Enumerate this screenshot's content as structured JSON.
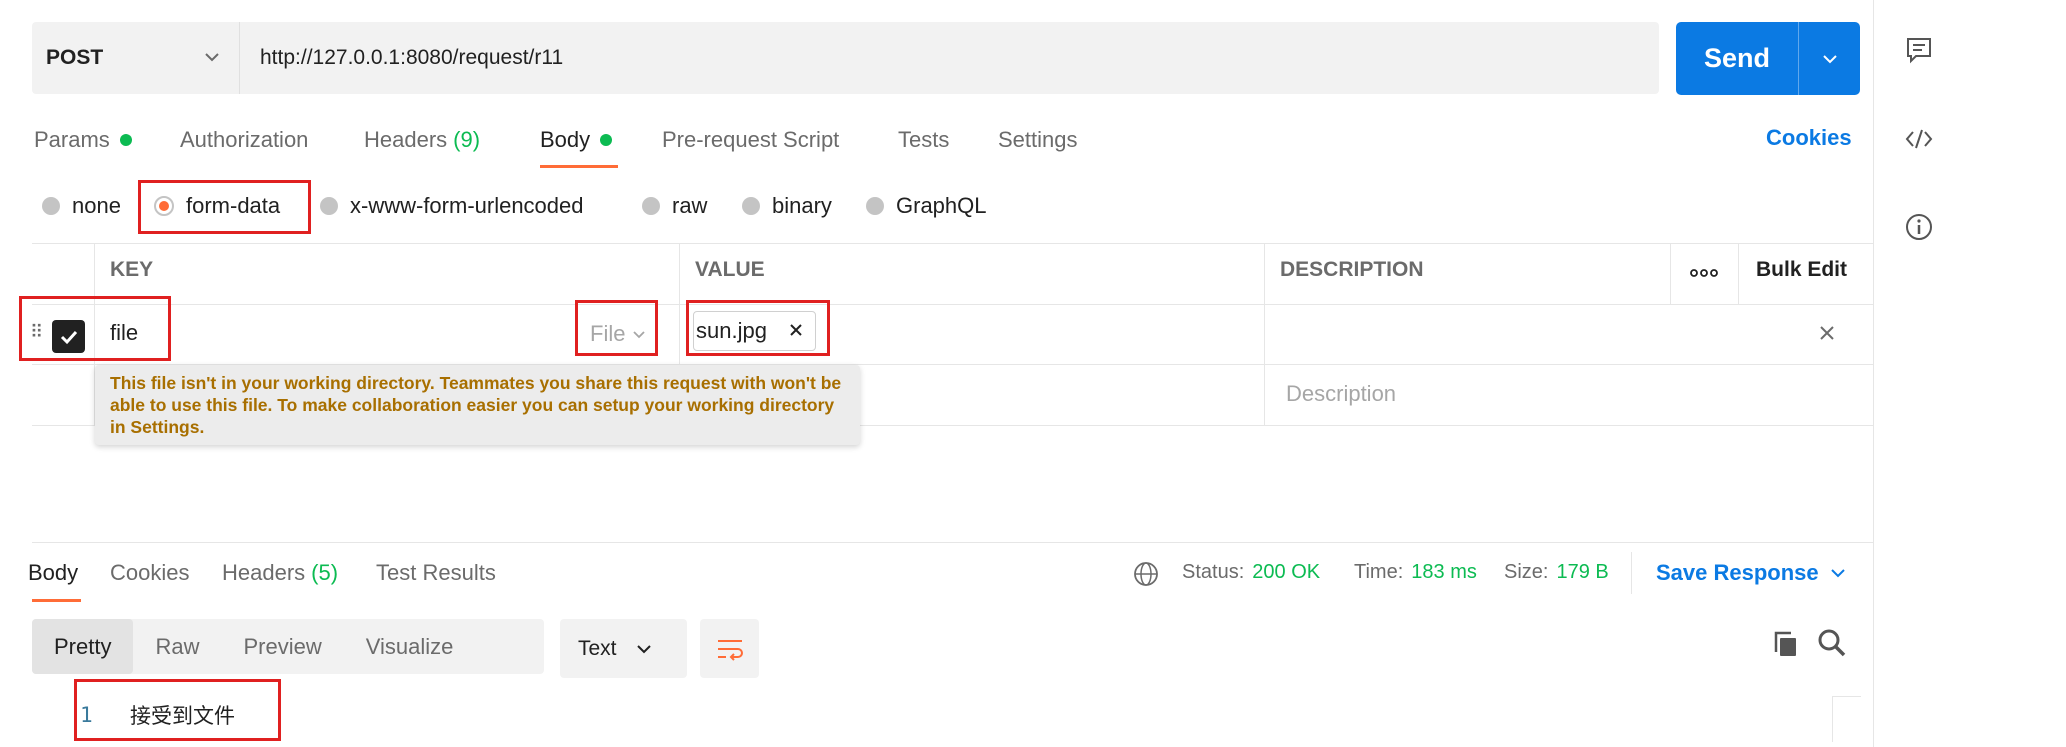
{
  "request": {
    "method": "POST",
    "url": "http://127.0.0.1:8080/request/r11",
    "send_label": "Send"
  },
  "tabs": {
    "params": "Params",
    "authorization": "Authorization",
    "headers": "Headers",
    "headers_count": "(9)",
    "body": "Body",
    "pre_request": "Pre-request Script",
    "tests": "Tests",
    "settings": "Settings",
    "cookies": "Cookies"
  },
  "body_types": {
    "none": "none",
    "form_data": "form-data",
    "urlencoded": "x-www-form-urlencoded",
    "raw": "raw",
    "binary": "binary",
    "graphql": "GraphQL",
    "selected": "form-data"
  },
  "table": {
    "headers": {
      "key": "KEY",
      "value": "VALUE",
      "description": "DESCRIPTION",
      "bulk_edit": "Bulk Edit"
    },
    "row": {
      "key": "file",
      "type": "File",
      "value": "sun.jpg"
    },
    "new_row": {
      "description_placeholder": "Description"
    }
  },
  "tooltip": "This file isn't in your working directory. Teammates you share this request with won't be able to use this file. To make collaboration easier you can setup your working directory in Settings.",
  "response": {
    "tabs": {
      "body": "Body",
      "cookies": "Cookies",
      "headers": "Headers",
      "headers_count": "(5)",
      "test_results": "Test Results"
    },
    "status_label": "Status:",
    "status_value": "200 OK",
    "time_label": "Time:",
    "time_value": "183 ms",
    "size_label": "Size:",
    "size_value": "179 B",
    "save_response": "Save Response",
    "views": {
      "pretty": "Pretty",
      "raw": "Raw",
      "preview": "Preview",
      "visualize": "Visualize"
    },
    "format": "Text",
    "lines": [
      {
        "number": "1",
        "text": "接受到文件"
      }
    ]
  },
  "colors": {
    "accent": "#ff6c37",
    "primary": "#0b7ae3",
    "success": "#0cbb52",
    "highlight": "#e02020"
  }
}
